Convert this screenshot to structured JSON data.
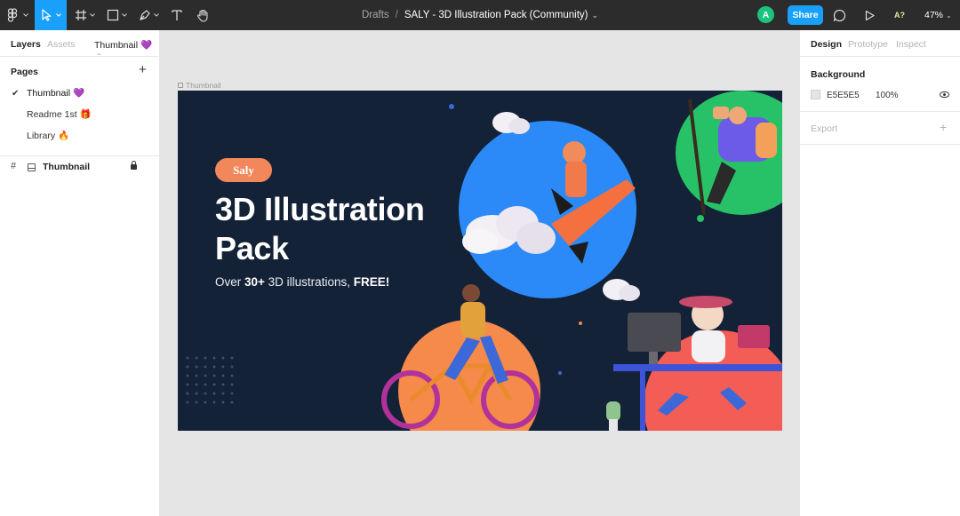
{
  "toolbar": {
    "breadcrumb_parent": "Drafts",
    "separator": "/",
    "file_name": "SALY - 3D Illustration Pack (Community)",
    "avatar_initial": "A",
    "avatar_color": "#1bc47d",
    "share_label": "Share",
    "accessibility_label": "A?",
    "zoom": "47%",
    "accent": "#18a0fb",
    "tools": [
      "figma-menu-icon",
      "move-tool-icon",
      "frame-tool-icon",
      "shape-tool-icon",
      "pen-tool-icon",
      "text-tool-icon",
      "hand-tool-icon"
    ]
  },
  "left_panel": {
    "tabs": [
      "Layers",
      "Assets"
    ],
    "page_selector": "Thumbnail 💜",
    "pages_header": "Pages",
    "pages": [
      {
        "label": "Thumbnail 💜",
        "selected": true
      },
      {
        "label": "Readme 1st 🎁",
        "selected": false
      },
      {
        "label": "Library 🔥",
        "selected": false
      }
    ],
    "layers": [
      {
        "label": "Thumbnail",
        "locked": true
      }
    ]
  },
  "canvas": {
    "frame_label": "Thumbnail",
    "thumbnail": {
      "badge": "Saly",
      "headline_line1": "3D Illustration",
      "headline_line2": "Pack",
      "sub_prefix": "Over ",
      "sub_bold1": "30+",
      "sub_mid": " 3D illustrations, ",
      "sub_bold2": "FREE!",
      "background_color": "#142238",
      "badge_color": "#f2875c"
    },
    "help_label": "?"
  },
  "right_panel": {
    "tabs": [
      "Design",
      "Prototype",
      "Inspect"
    ],
    "background_title": "Background",
    "background_hex": "E5E5E5",
    "background_opacity": "100%",
    "export_title": "Export"
  }
}
